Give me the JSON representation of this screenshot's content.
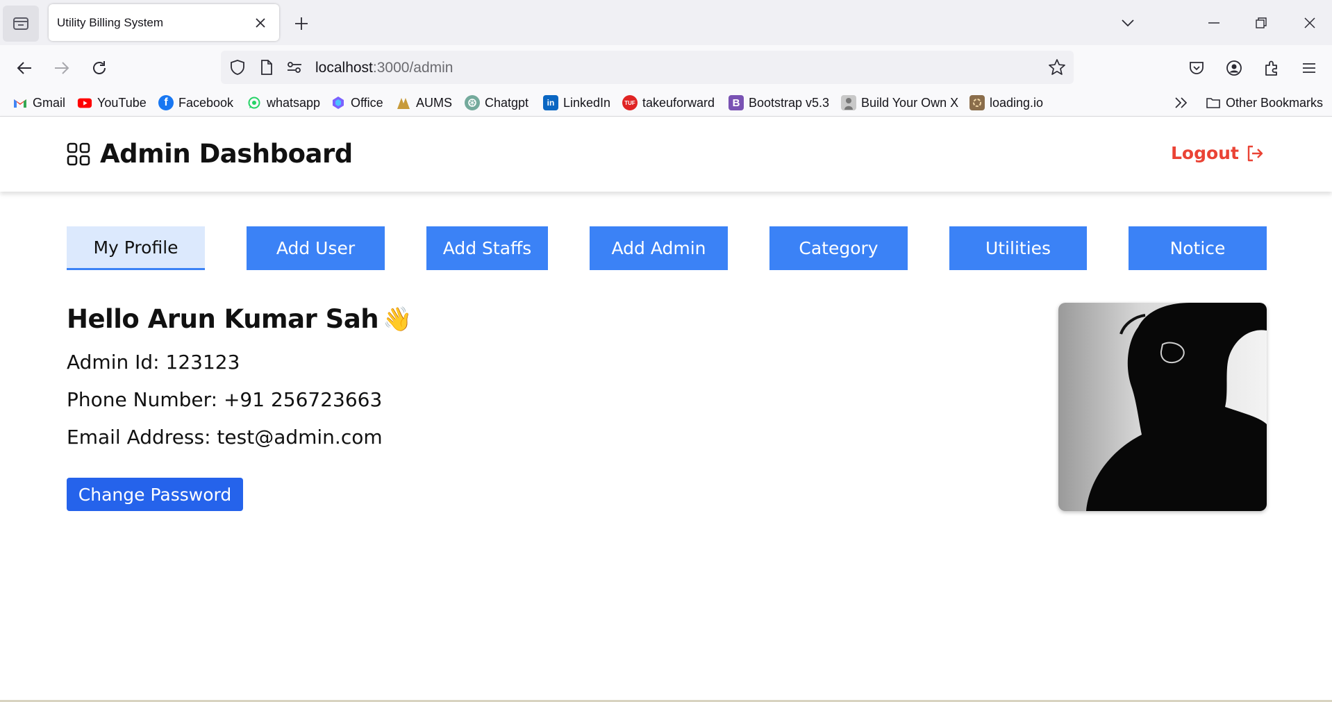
{
  "browser": {
    "tab_title": "Utility Billing System",
    "url_host": "localhost",
    "url_path": ":3000/admin",
    "bookmarks": [
      {
        "label": "Gmail",
        "icon": "gmail-icon",
        "color": "#ea4335"
      },
      {
        "label": "YouTube",
        "icon": "youtube-icon",
        "color": "#ff0000"
      },
      {
        "label": "Facebook",
        "icon": "facebook-icon",
        "color": "#1877f2"
      },
      {
        "label": "whatsapp",
        "icon": "whatsapp-icon",
        "color": "#25d366"
      },
      {
        "label": "Office",
        "icon": "office-icon",
        "color": "#7b61ff"
      },
      {
        "label": "AUMS",
        "icon": "aums-icon",
        "color": "#c79a3a"
      },
      {
        "label": "Chatgpt",
        "icon": "chatgpt-icon",
        "color": "#74aa9c"
      },
      {
        "label": "LinkedIn",
        "icon": "linkedin-icon",
        "color": "#0a66c2"
      },
      {
        "label": "takeuforward",
        "icon": "takeuforward-icon",
        "color": "#e02424"
      },
      {
        "label": "Bootstrap v5.3",
        "icon": "bootstrap-icon",
        "color": "#7952b3"
      },
      {
        "label": "Build Your Own X",
        "icon": "build-your-own-x-icon",
        "color": "#888888"
      },
      {
        "label": "loading.io",
        "icon": "loading-io-icon",
        "color": "#8a6d4b"
      }
    ],
    "other_bookmarks": "Other Bookmarks"
  },
  "header": {
    "title": "Admin Dashboard",
    "logout_label": "Logout",
    "accent": "#ea4335"
  },
  "tabs": [
    {
      "label": "My Profile",
      "active": true
    },
    {
      "label": "Add User",
      "active": false
    },
    {
      "label": "Add Staffs",
      "active": false
    },
    {
      "label": "Add Admin",
      "active": false
    },
    {
      "label": "Category",
      "active": false
    },
    {
      "label": "Utilities",
      "active": false
    },
    {
      "label": "Notice",
      "active": false
    }
  ],
  "profile": {
    "greeting": "Hello Arun Kumar Sah",
    "greeting_emoji": "👋",
    "admin_id": "Admin Id: 123123",
    "phone": "Phone Number: +91 256723663",
    "email": "Email Address: test@admin.com",
    "change_password_label": "Change Password"
  },
  "colors": {
    "primary": "#3b82f6",
    "button_dark": "#2563eb",
    "active_tab_bg": "#dce9fd"
  }
}
